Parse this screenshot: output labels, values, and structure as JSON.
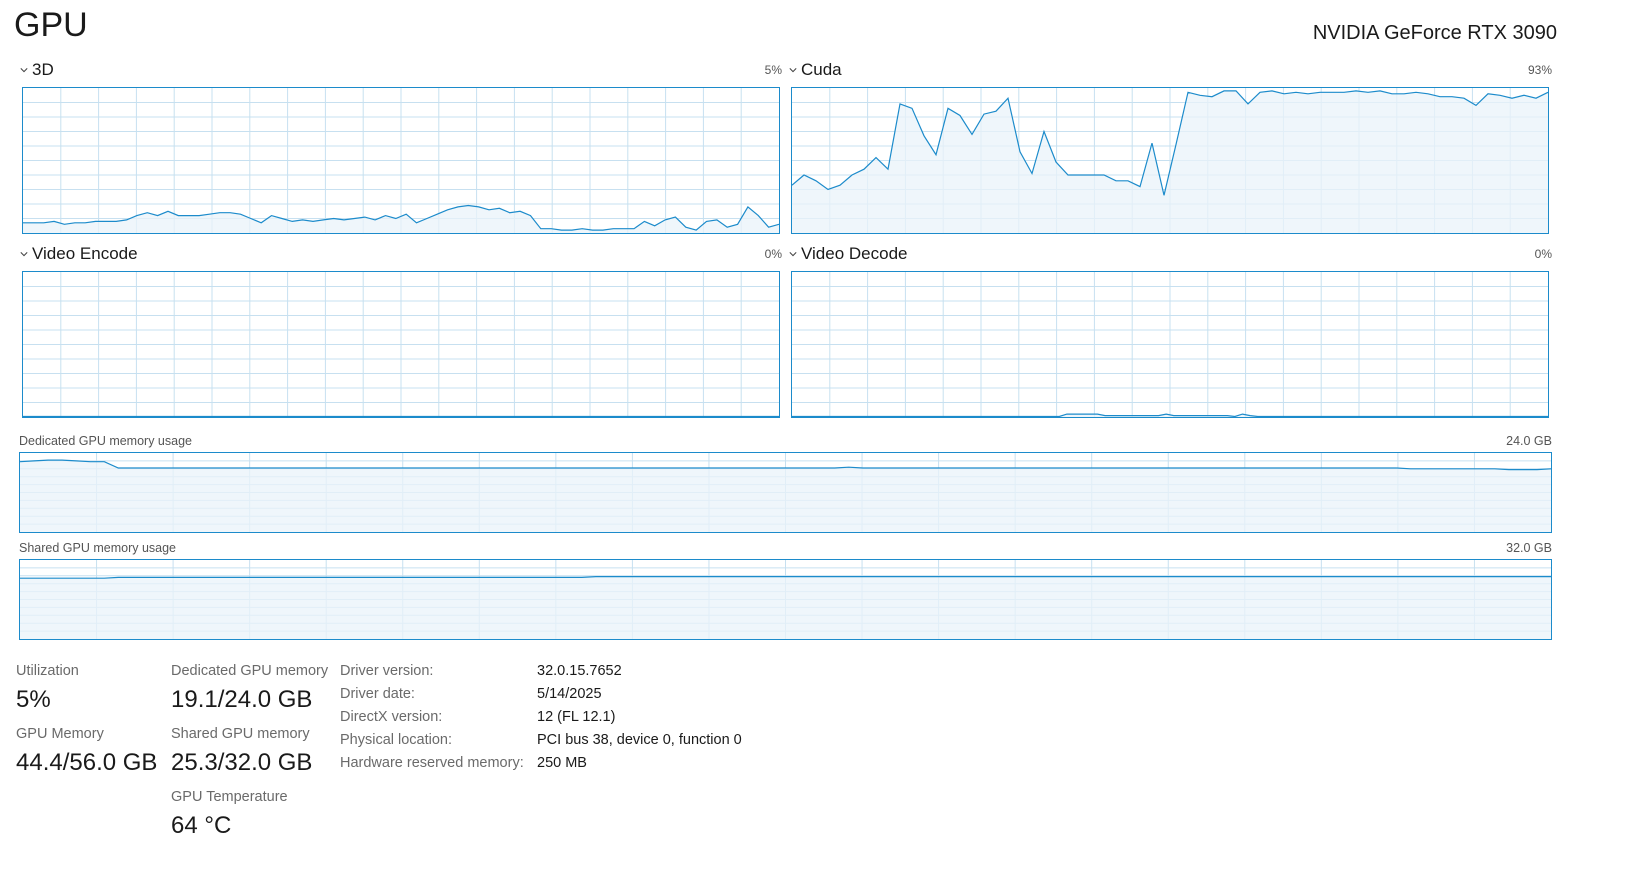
{
  "header": {
    "title": "GPU",
    "device_name": "NVIDIA GeForce RTX 3090"
  },
  "colors": {
    "graph_line": "#1c8bcb",
    "graph_fill": "#e9f3fa",
    "grid": "#c7e0f0",
    "text": "#1a1a1a",
    "muted": "#6a6a6a"
  },
  "graphs": {
    "g3d": {
      "label": "3D",
      "percent": "5%",
      "values": [
        7,
        7,
        7,
        8,
        6,
        7,
        7,
        8,
        8,
        8,
        9,
        12,
        14,
        12,
        15,
        12,
        12,
        12,
        13,
        14,
        14,
        13,
        10,
        7,
        12,
        10,
        8,
        9,
        8,
        9,
        10,
        9,
        10,
        11,
        9,
        12,
        10,
        13,
        7,
        10,
        13,
        16,
        18,
        19,
        18,
        16,
        17,
        14,
        15,
        12,
        3,
        3,
        2,
        2,
        3,
        2,
        2,
        3,
        3,
        3,
        8,
        5,
        9,
        11,
        4,
        2,
        8,
        9,
        4,
        6,
        18,
        12,
        4,
        6
      ]
    },
    "cuda": {
      "label": "Cuda",
      "percent": "93%",
      "values": [
        33,
        40,
        36,
        30,
        33,
        40,
        44,
        52,
        44,
        89,
        86,
        67,
        54,
        86,
        81,
        68,
        82,
        84,
        93,
        56,
        41,
        70,
        49,
        40,
        40,
        40,
        40,
        36,
        36,
        32,
        62,
        26,
        61,
        97,
        95,
        94,
        98,
        98,
        89,
        97,
        98,
        96,
        97,
        96,
        97,
        97,
        97,
        98,
        97,
        98,
        96,
        96,
        97,
        96,
        94,
        94,
        93,
        88,
        96,
        95,
        93,
        95,
        93,
        97
      ]
    },
    "encode": {
      "label": "Video Encode",
      "percent": "0%",
      "values": [
        0,
        0,
        0,
        0,
        0,
        0,
        0,
        0,
        0,
        0,
        0,
        0,
        0,
        0,
        0,
        0,
        0,
        0,
        0,
        0,
        0,
        0,
        0,
        0
      ]
    },
    "decode": {
      "label": "Video Decode",
      "percent": "0%",
      "values": [
        0,
        0,
        0,
        0,
        0,
        0,
        0,
        0,
        0,
        0,
        0,
        0,
        0,
        0,
        0,
        0,
        0,
        0,
        0,
        0,
        0,
        0,
        0,
        0,
        0,
        0,
        0,
        0,
        0,
        0,
        0,
        0,
        0,
        0,
        0,
        0,
        2,
        2,
        2,
        2,
        2,
        1,
        1,
        1,
        1,
        1,
        1,
        1,
        1,
        2,
        1,
        1,
        1,
        1,
        1,
        1,
        1,
        1,
        0,
        2,
        1,
        0,
        0,
        0,
        0,
        0,
        0,
        0,
        0,
        0,
        0,
        0,
        0,
        0,
        0,
        0,
        0,
        0,
        0,
        0,
        0,
        0,
        0,
        0,
        0,
        0,
        0,
        0,
        0,
        0,
        0,
        0,
        0,
        0,
        0,
        0,
        0,
        0,
        0,
        0
      ]
    },
    "dedicated": {
      "label": "Dedicated GPU memory usage",
      "max": "24.0 GB",
      "values": [
        89,
        90,
        91,
        91,
        90,
        89,
        89,
        81,
        81,
        81,
        81,
        81,
        81,
        81,
        81,
        81,
        81,
        81,
        81,
        81,
        81,
        81,
        81,
        81,
        81,
        81,
        81,
        81,
        81,
        81,
        81,
        81,
        81,
        81,
        81,
        81,
        81,
        81,
        81,
        81,
        81,
        81,
        81,
        81,
        81,
        81,
        81,
        81,
        81,
        81,
        81,
        81,
        81,
        81,
        81,
        81,
        81,
        81,
        81,
        82,
        81,
        81,
        81,
        81,
        81,
        81,
        81,
        81,
        81,
        81,
        81,
        81,
        81,
        81,
        81,
        81,
        81,
        81,
        81,
        81,
        81,
        81,
        81,
        81,
        81,
        81,
        81,
        81,
        81,
        81,
        81,
        81,
        81,
        81,
        81,
        81,
        81,
        81,
        81,
        80,
        80,
        80,
        80,
        80,
        80,
        80,
        79,
        79,
        79,
        80
      ]
    },
    "shared": {
      "label": "Shared GPU memory usage",
      "max": "32.0 GB",
      "values": [
        77,
        77,
        77,
        77,
        77,
        77,
        77,
        78,
        78,
        78,
        78,
        78,
        78,
        78,
        78,
        78,
        78,
        78,
        78,
        78,
        78,
        78,
        78,
        78,
        78,
        78,
        78,
        78,
        78,
        78,
        78,
        78,
        78,
        78,
        78,
        78,
        78,
        78,
        78,
        78,
        78,
        79,
        79,
        79,
        79,
        79,
        79,
        79,
        79,
        79,
        79,
        79,
        79,
        79,
        79,
        79,
        79,
        79,
        79,
        79,
        79,
        79,
        79,
        79,
        79,
        79,
        79,
        79,
        79,
        79,
        79,
        79,
        79,
        79,
        79,
        79,
        79,
        79,
        79,
        79,
        79,
        79,
        79,
        79,
        79,
        79,
        79,
        79,
        79,
        79,
        79,
        79,
        79,
        79,
        79,
        79,
        79,
        79,
        79,
        79,
        79,
        79,
        79,
        79,
        79,
        79,
        79,
        79,
        79,
        79
      ]
    }
  },
  "stats": {
    "utilization_label": "Utilization",
    "utilization_value": "5%",
    "dedicated_label": "Dedicated GPU memory",
    "dedicated_value": "19.1/24.0 GB",
    "gpu_memory_label": "GPU Memory",
    "gpu_memory_value": "44.4/56.0 GB",
    "shared_label": "Shared GPU memory",
    "shared_value": "25.3/32.0 GB",
    "temp_label": "GPU Temperature",
    "temp_value": "64 °C"
  },
  "info": [
    {
      "label": "Driver version:",
      "value": "32.0.15.7652"
    },
    {
      "label": "Driver date:",
      "value": "5/14/2025"
    },
    {
      "label": "DirectX version:",
      "value": "12 (FL 12.1)"
    },
    {
      "label": "Physical location:",
      "value": "PCI bus 38, device 0, function 0"
    },
    {
      "label": "Hardware reserved memory:",
      "value": "250 MB"
    }
  ]
}
